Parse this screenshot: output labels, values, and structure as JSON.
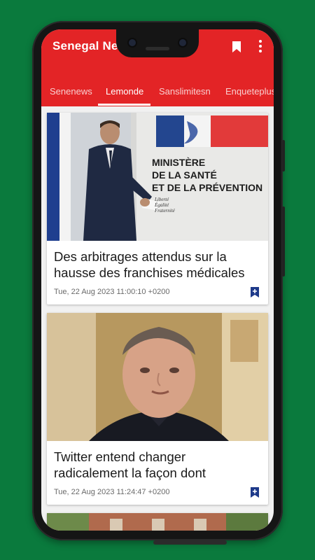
{
  "app": {
    "title": "Senegal News",
    "actions": [
      "bookmark-icon",
      "more-vert-icon"
    ]
  },
  "tabs": [
    {
      "label": "Senenews"
    },
    {
      "label": "Lemonde"
    },
    {
      "label": "Sanslimitesn"
    },
    {
      "label": "Enqueteplus"
    }
  ],
  "selected_tab": "Lemonde",
  "articles": [
    {
      "title": "Des arbitrages attendus sur la hausse des franchises médicales",
      "date": "Tue, 22 Aug 2023 11:00:10 +0200",
      "image": {
        "sign_lines": [
          "MINISTÈRE",
          "DE LA SANTÉ",
          "ET DE LA PRÉVENTION"
        ],
        "motto_lines": [
          "Liberté",
          "Égalité",
          "Fraternité"
        ]
      }
    },
    {
      "title": "Twitter entend changer radicalement la façon dont",
      "date": "Tue, 22 Aug 2023 11:24:47 +0200"
    }
  ],
  "colors": {
    "background": "#0a7a3d",
    "appbar": "#e32426",
    "bookmark_accent": "#1e3a8a"
  }
}
